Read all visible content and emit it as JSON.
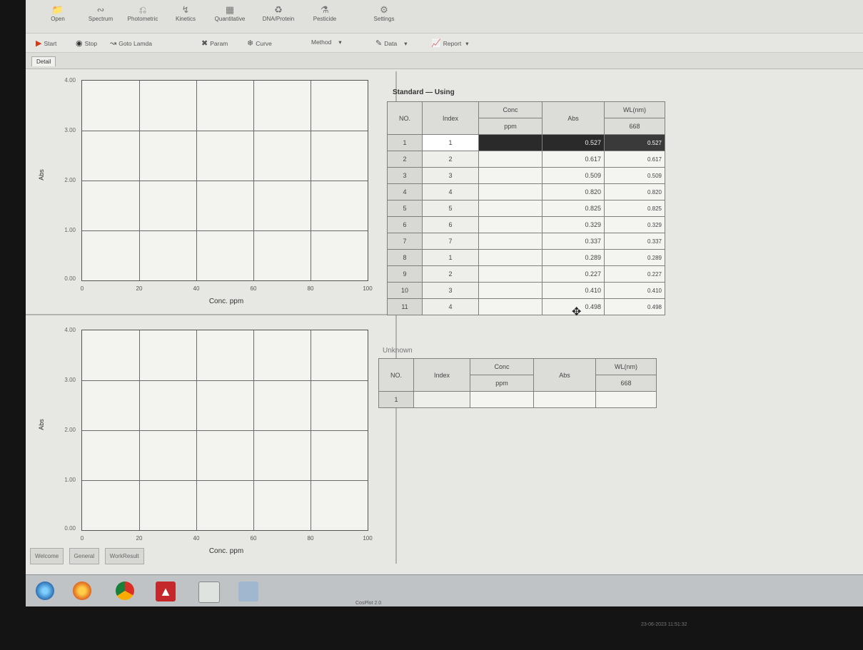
{
  "ribbon": {
    "items": [
      {
        "label": "Open",
        "icon": "folder-icon"
      },
      {
        "label": "Spectrum",
        "icon": "spectrum-icon"
      },
      {
        "label": "Photometric",
        "icon": "photometric-icon"
      },
      {
        "label": "Kinetics",
        "icon": "kinetics-icon"
      },
      {
        "label": "Quantitative",
        "icon": "quantitative-icon"
      },
      {
        "label": "DNA/Protein",
        "icon": "dna-icon"
      },
      {
        "label": "Pesticide",
        "icon": "pesticide-icon"
      },
      {
        "label": "Settings",
        "icon": "settings-icon"
      }
    ]
  },
  "toolbar": {
    "start": "Start",
    "stop": "Stop",
    "goto": "Goto Lamda",
    "param": "Param",
    "curve": "Curve",
    "method": "Method",
    "data": "Data",
    "report": "Report"
  },
  "tab": {
    "label": "Detail"
  },
  "chart_top": {
    "yticks": [
      "4.00",
      "3.00",
      "2.00",
      "1.00",
      "0.00"
    ],
    "xticks": [
      "0",
      "20",
      "40",
      "60",
      "80",
      "100"
    ],
    "xlabel": "Conc. ppm",
    "ylabel": "Abs"
  },
  "chart_bottom": {
    "yticks": [
      "4.00",
      "3.00",
      "2.00",
      "1.00",
      "0.00"
    ],
    "xticks": [
      "0",
      "20",
      "40",
      "60",
      "80",
      "100"
    ],
    "xlabel": "Conc. ppm",
    "ylabel": "Abs"
  },
  "standard": {
    "title": "Standard — Using",
    "headers": {
      "no": "NO.",
      "index": "Index",
      "conc": "Conc",
      "conc_unit": "ppm",
      "abs": "Abs",
      "wl": "WL(nm)",
      "wl_value": "668"
    },
    "rows": [
      {
        "no": "1",
        "index": "1",
        "abs": "0.527",
        "wl": "0.527"
      },
      {
        "no": "2",
        "index": "2",
        "abs": "0.617",
        "wl": "0.617"
      },
      {
        "no": "3",
        "index": "3",
        "abs": "0.509",
        "wl": "0.509"
      },
      {
        "no": "4",
        "index": "4",
        "abs": "0.820",
        "wl": "0.820"
      },
      {
        "no": "5",
        "index": "5",
        "abs": "0.825",
        "wl": "0.825"
      },
      {
        "no": "6",
        "index": "6",
        "abs": "0.329",
        "wl": "0.329"
      },
      {
        "no": "7",
        "index": "7",
        "abs": "0.337",
        "wl": "0.337"
      },
      {
        "no": "8",
        "index": "1",
        "abs": "0.289",
        "wl": "0.289"
      },
      {
        "no": "9",
        "index": "2",
        "abs": "0.227",
        "wl": "0.227"
      },
      {
        "no": "10",
        "index": "3",
        "abs": "0.410",
        "wl": "0.410"
      },
      {
        "no": "11",
        "index": "4",
        "abs": "0.498",
        "wl": "0.498"
      }
    ]
  },
  "unknown": {
    "title": "Unknown",
    "headers": {
      "no": "NO.",
      "index": "Index",
      "conc": "Conc",
      "conc_unit": "ppm",
      "abs": "Abs",
      "wl": "WL(nm)",
      "wl_value": "668"
    },
    "rows": [
      {
        "no": "1"
      }
    ]
  },
  "bottom_tabs": [
    "Welcome",
    "General",
    "WorkResult"
  ],
  "taskbar": {
    "label": "CosPlot 2.0",
    "clock": "23-06-2023 11:51:32"
  },
  "colors": {
    "selected_row": "#2a2a2a",
    "grid_line": "#6a6a6a",
    "panel_bg": "#e7e8e3"
  }
}
